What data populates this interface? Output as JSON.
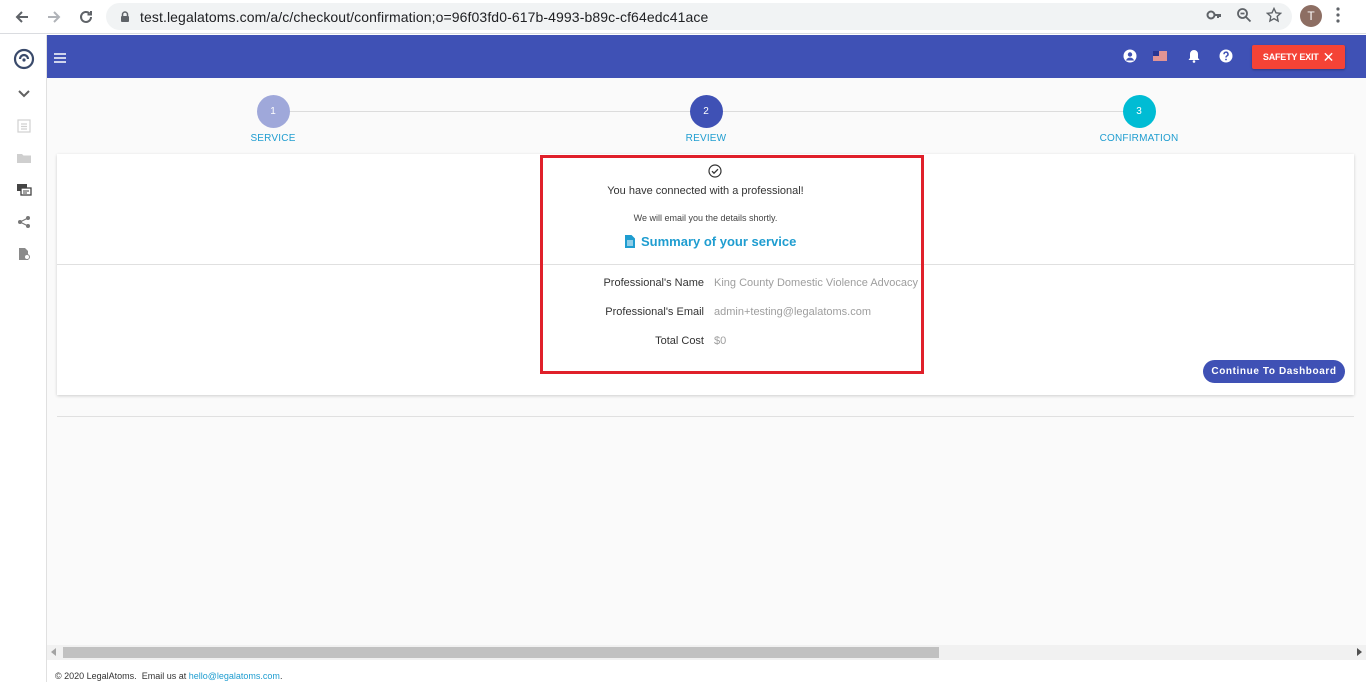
{
  "browser": {
    "url": "test.legalatoms.com/a/c/checkout/confirmation;o=96f03fd0-617b-4993-b89c-cf64edc41ace",
    "profile_initial": "T"
  },
  "header": {
    "safety_exit_label": "SAFETY EXIT",
    "color": "#3f51b5",
    "safety_color": "#f44336"
  },
  "stepper": {
    "steps": [
      {
        "number": "1",
        "label": "SERVICE",
        "color": "#9fa8da"
      },
      {
        "number": "2",
        "label": "REVIEW",
        "color": "#3f51b5"
      },
      {
        "number": "3",
        "label": "CONFIRMATION",
        "color": "#00bcd4"
      }
    ]
  },
  "confirmation": {
    "title": "You have connected with a professional!",
    "subtitle": "We will email you the details shortly.",
    "summary_link": "Summary of your service",
    "details": [
      {
        "label": "Professional's Name",
        "value": "King County Domestic Violence Advocacy"
      },
      {
        "label": "Professional's Email",
        "value": "admin+testing@legalatoms.com"
      },
      {
        "label": "Total Cost",
        "value": "$0"
      }
    ],
    "continue_label": "Continue To Dashboard"
  },
  "footer": {
    "copyright": "© 2020 LegalAtoms.",
    "email_prefix": "Email us at",
    "email": "hello@legalatoms.com",
    "email_suffix": "."
  }
}
